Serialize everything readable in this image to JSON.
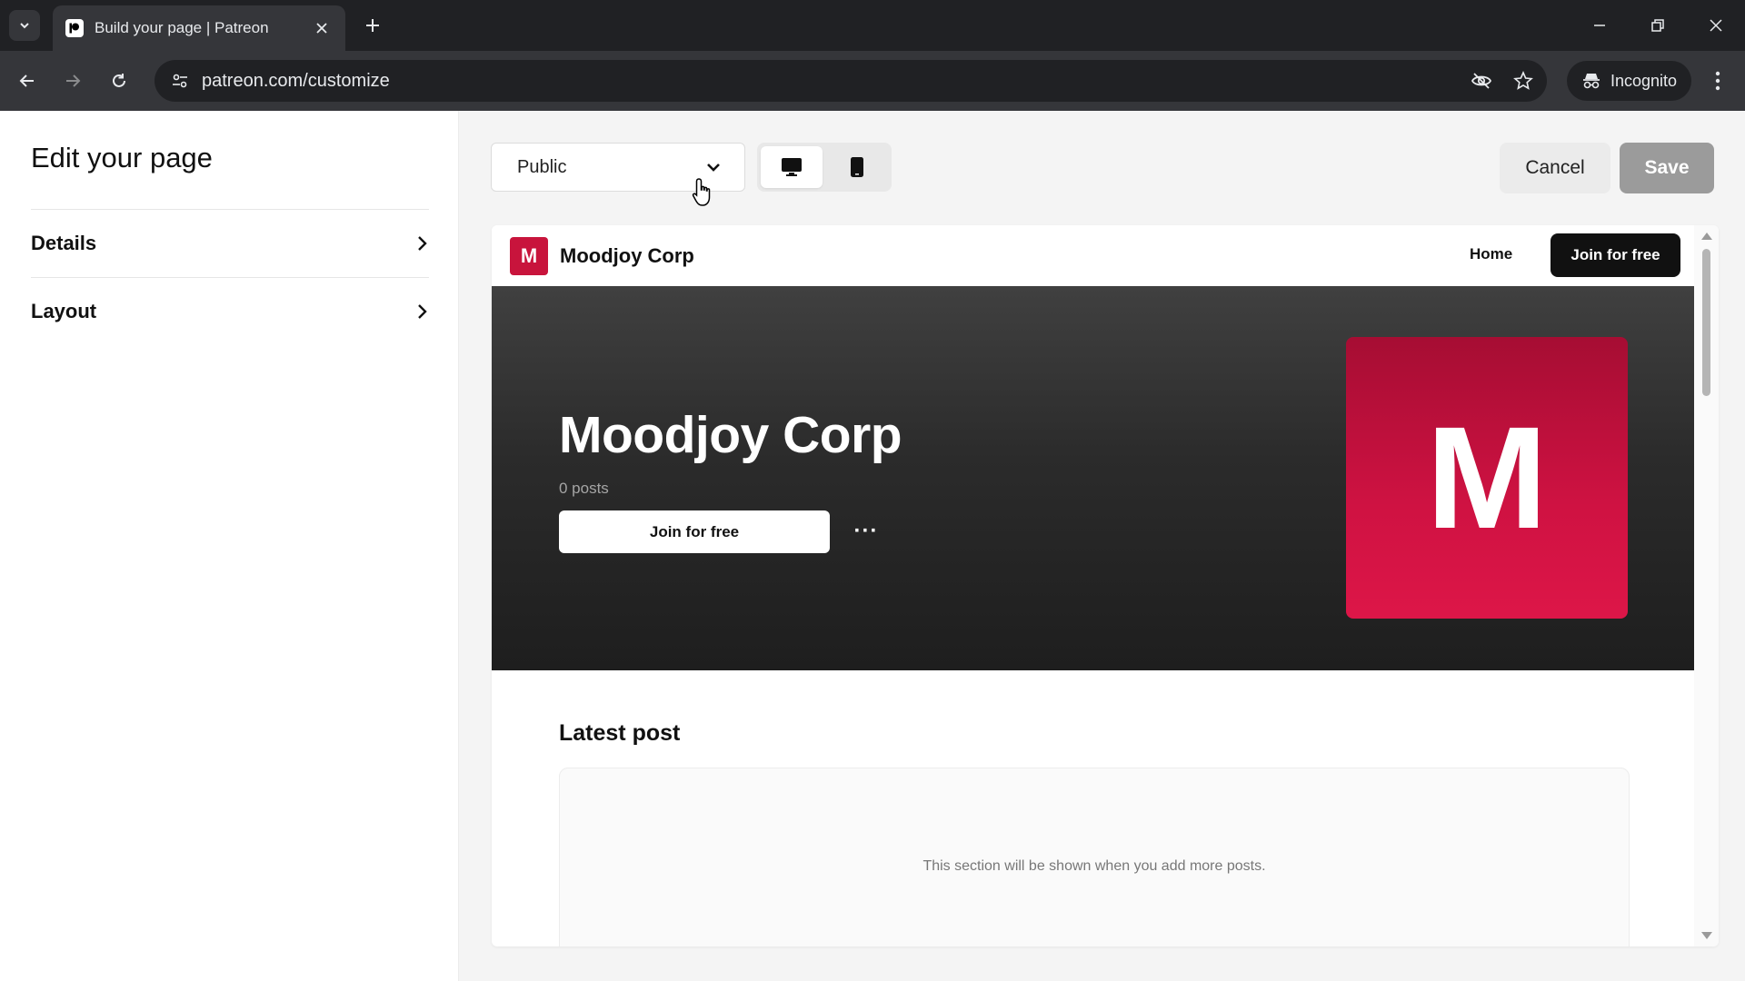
{
  "browser": {
    "tab_title": "Build your page | Patreon",
    "url": "patreon.com/customize",
    "incognito_label": "Incognito"
  },
  "editor": {
    "title": "Edit your page",
    "items": [
      {
        "label": "Details"
      },
      {
        "label": "Layout"
      }
    ]
  },
  "toolbar": {
    "visibility_value": "Public",
    "cancel_label": "Cancel",
    "save_label": "Save"
  },
  "preview": {
    "logo_letter": "M",
    "creator_name": "Moodjoy Corp",
    "nav_home": "Home",
    "nav_join": "Join for free",
    "hero_title": "Moodjoy Corp",
    "posts_count": "0 posts",
    "hero_join": "Join for free",
    "more_label": "···",
    "avatar_letter": "M",
    "latest_post_title": "Latest post",
    "latest_post_empty": "This section will be shown when you add more posts."
  },
  "colors": {
    "brand_red": "#c8143c",
    "save_disabled": "#9b9b9b",
    "browser_dark": "#202124"
  }
}
